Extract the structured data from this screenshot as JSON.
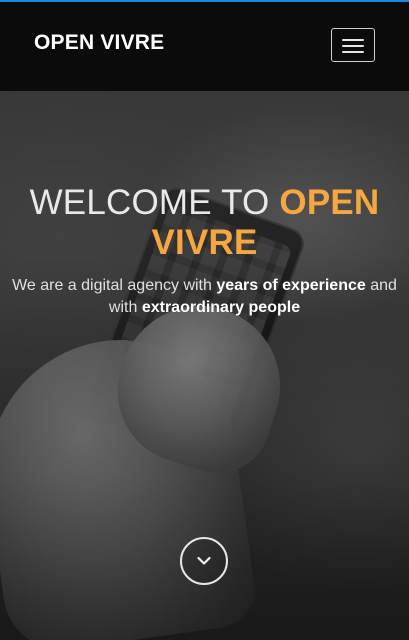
{
  "navbar": {
    "brand": "OPEN VIVRE",
    "menu_icon": "hamburger-menu-icon"
  },
  "hero": {
    "title_prefix": "WELCOME TO",
    "title_highlight": "OPEN VIVRE",
    "subtitle_part1": "We are a digital agency with",
    "subtitle_bold1": "years of experience",
    "subtitle_part2": "and with",
    "subtitle_bold2": "extraordinary people",
    "scroll_icon": "chevron-down-icon"
  },
  "colors": {
    "navbar_bg": "#0b0b0b",
    "accent": "#f7a740",
    "top_accent": "#1e88e5",
    "text_light": "#e9e9e9"
  }
}
